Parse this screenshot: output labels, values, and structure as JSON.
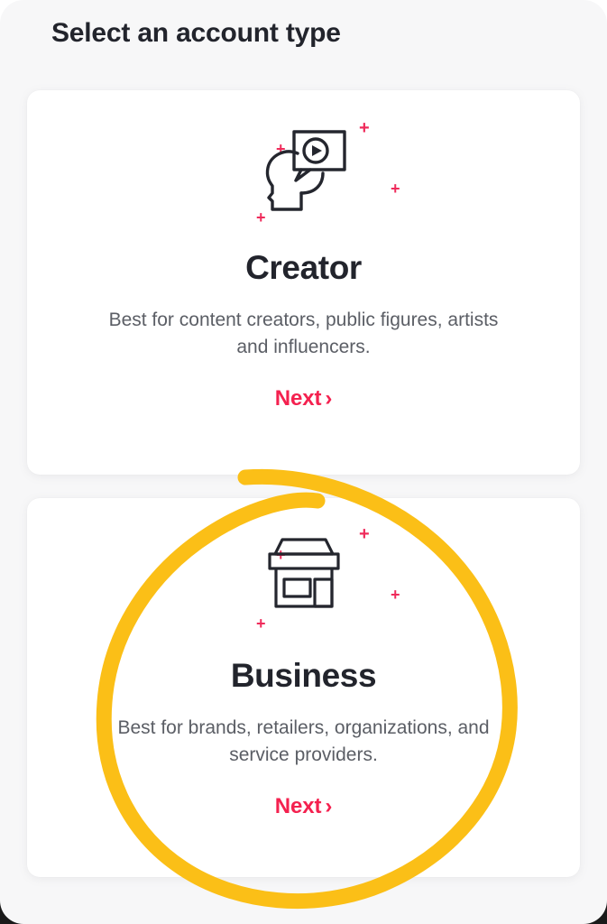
{
  "page": {
    "title": "Select an account type",
    "background_color": "#f7f7f8",
    "accent_pink": "#f4214f",
    "title_color": "#22242c",
    "annotation_color": "#fbbf17"
  },
  "cards": [
    {
      "id": "creator",
      "icon": "head-with-video-speech-bubble-icon",
      "title": "Creator",
      "description": "Best for content creators, public figures, artists and influencers.",
      "next_label": "Next",
      "next_chevron": "›"
    },
    {
      "id": "business",
      "icon": "storefront-icon",
      "title": "Business",
      "description": "Best for brands, retailers, organizations, and service providers.",
      "next_label": "Next",
      "next_chevron": "›"
    }
  ],
  "annotation": {
    "shape": "hand-drawn-circle",
    "color": "#fbbf17",
    "target": "business"
  }
}
